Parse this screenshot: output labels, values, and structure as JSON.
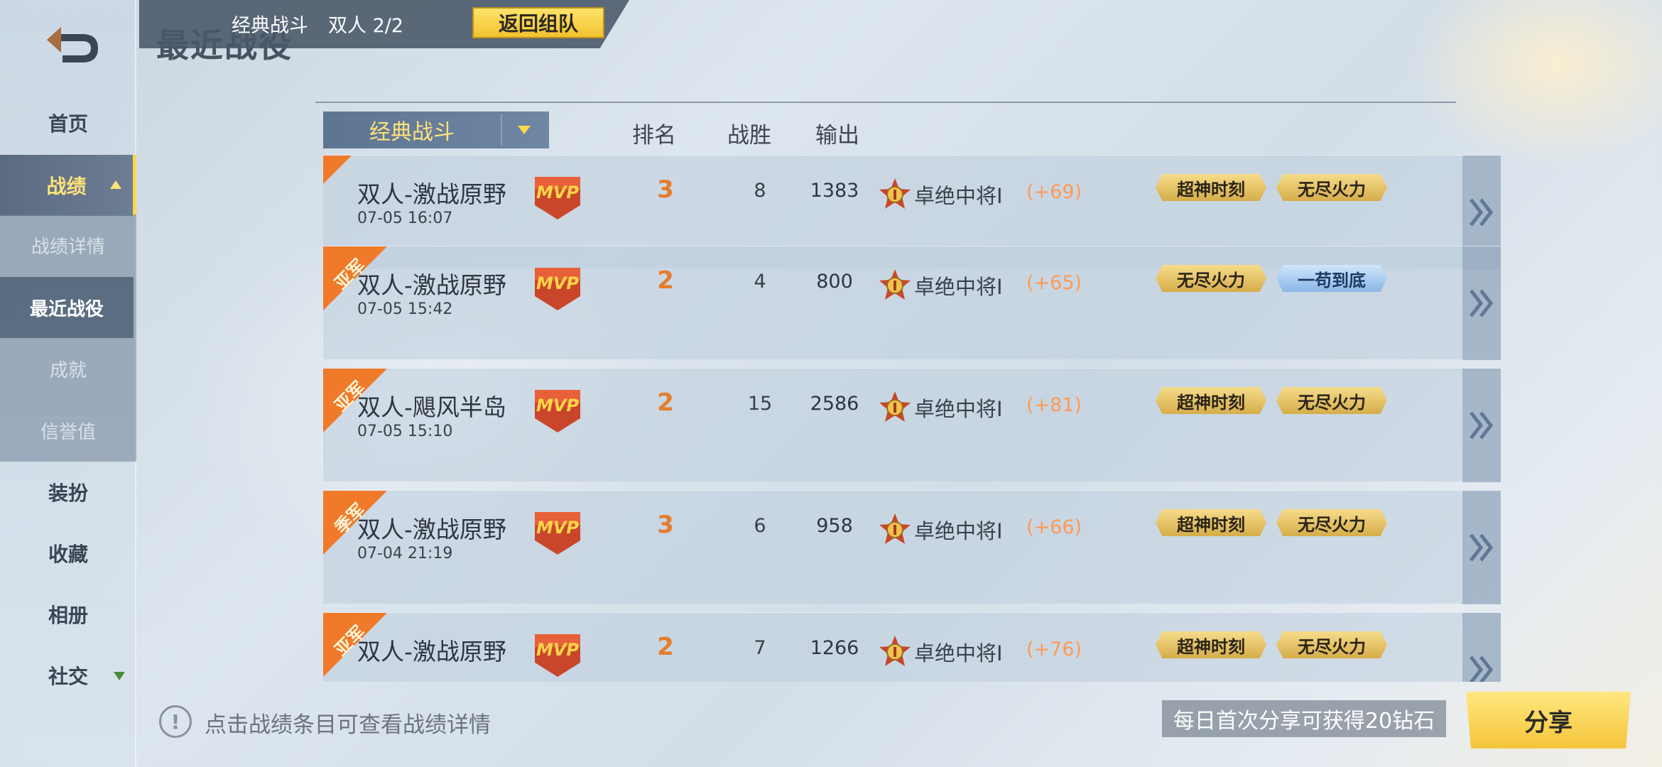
{
  "header": {
    "page_title": "最近战役",
    "team_bar_title": "经典战斗",
    "team_mode": "双人 2/2",
    "return_team_label": "返回组队"
  },
  "sidebar": {
    "items": [
      {
        "label": "首页"
      },
      {
        "label": "战绩"
      },
      {
        "label": "装扮"
      },
      {
        "label": "收藏"
      },
      {
        "label": "相册"
      },
      {
        "label": "社交"
      }
    ],
    "sub_items": [
      {
        "label": "战绩详情"
      },
      {
        "label": "最近战役"
      },
      {
        "label": "成就"
      },
      {
        "label": "信誉值"
      }
    ]
  },
  "filter": {
    "mode_label": "经典战斗"
  },
  "columns": {
    "rank": "排名",
    "wins": "战胜",
    "damage": "输出"
  },
  "matches": [
    {
      "ribbon": "",
      "map": "双人-激战原野",
      "time": "07-05 16:07",
      "rank": "3",
      "wins": "8",
      "damage": "1383",
      "tier": "卓绝中将I",
      "gain": "(+69)",
      "tags": [
        "超神时刻",
        "无尽火力"
      ]
    },
    {
      "ribbon": "亚军",
      "map": "双人-激战原野",
      "time": "07-05 15:42",
      "rank": "2",
      "wins": "4",
      "damage": "800",
      "tier": "卓绝中将I",
      "gain": "(+65)",
      "tags": [
        "无尽火力",
        "一苟到底"
      ]
    },
    {
      "ribbon": "亚军",
      "map": "双人-飓风半岛",
      "time": "07-05 15:10",
      "rank": "2",
      "wins": "15",
      "damage": "2586",
      "tier": "卓绝中将I",
      "gain": "(+81)",
      "tags": [
        "超神时刻",
        "无尽火力"
      ]
    },
    {
      "ribbon": "季军",
      "map": "双人-激战原野",
      "time": "07-04 21:19",
      "rank": "3",
      "wins": "6",
      "damage": "958",
      "tier": "卓绝中将I",
      "gain": "(+66)",
      "tags": [
        "超神时刻",
        "无尽火力"
      ]
    },
    {
      "ribbon": "亚军",
      "map": "双人-激战原野",
      "time": "",
      "rank": "2",
      "wins": "7",
      "damage": "1266",
      "tier": "卓绝中将I",
      "gain": "(+76)",
      "tags": [
        "超神时刻",
        "无尽火力"
      ]
    }
  ],
  "footer": {
    "hint": "点击战绩条目可查看战绩详情",
    "share_note": "每日首次分享可获得20钻石",
    "share_label": "分享"
  },
  "colors": {
    "accent_yellow": "#ffd84a",
    "rank_orange": "#e47d2d",
    "ribbon_orange": "#f07a2a"
  },
  "badges": {
    "mvp_text": "MVP"
  }
}
